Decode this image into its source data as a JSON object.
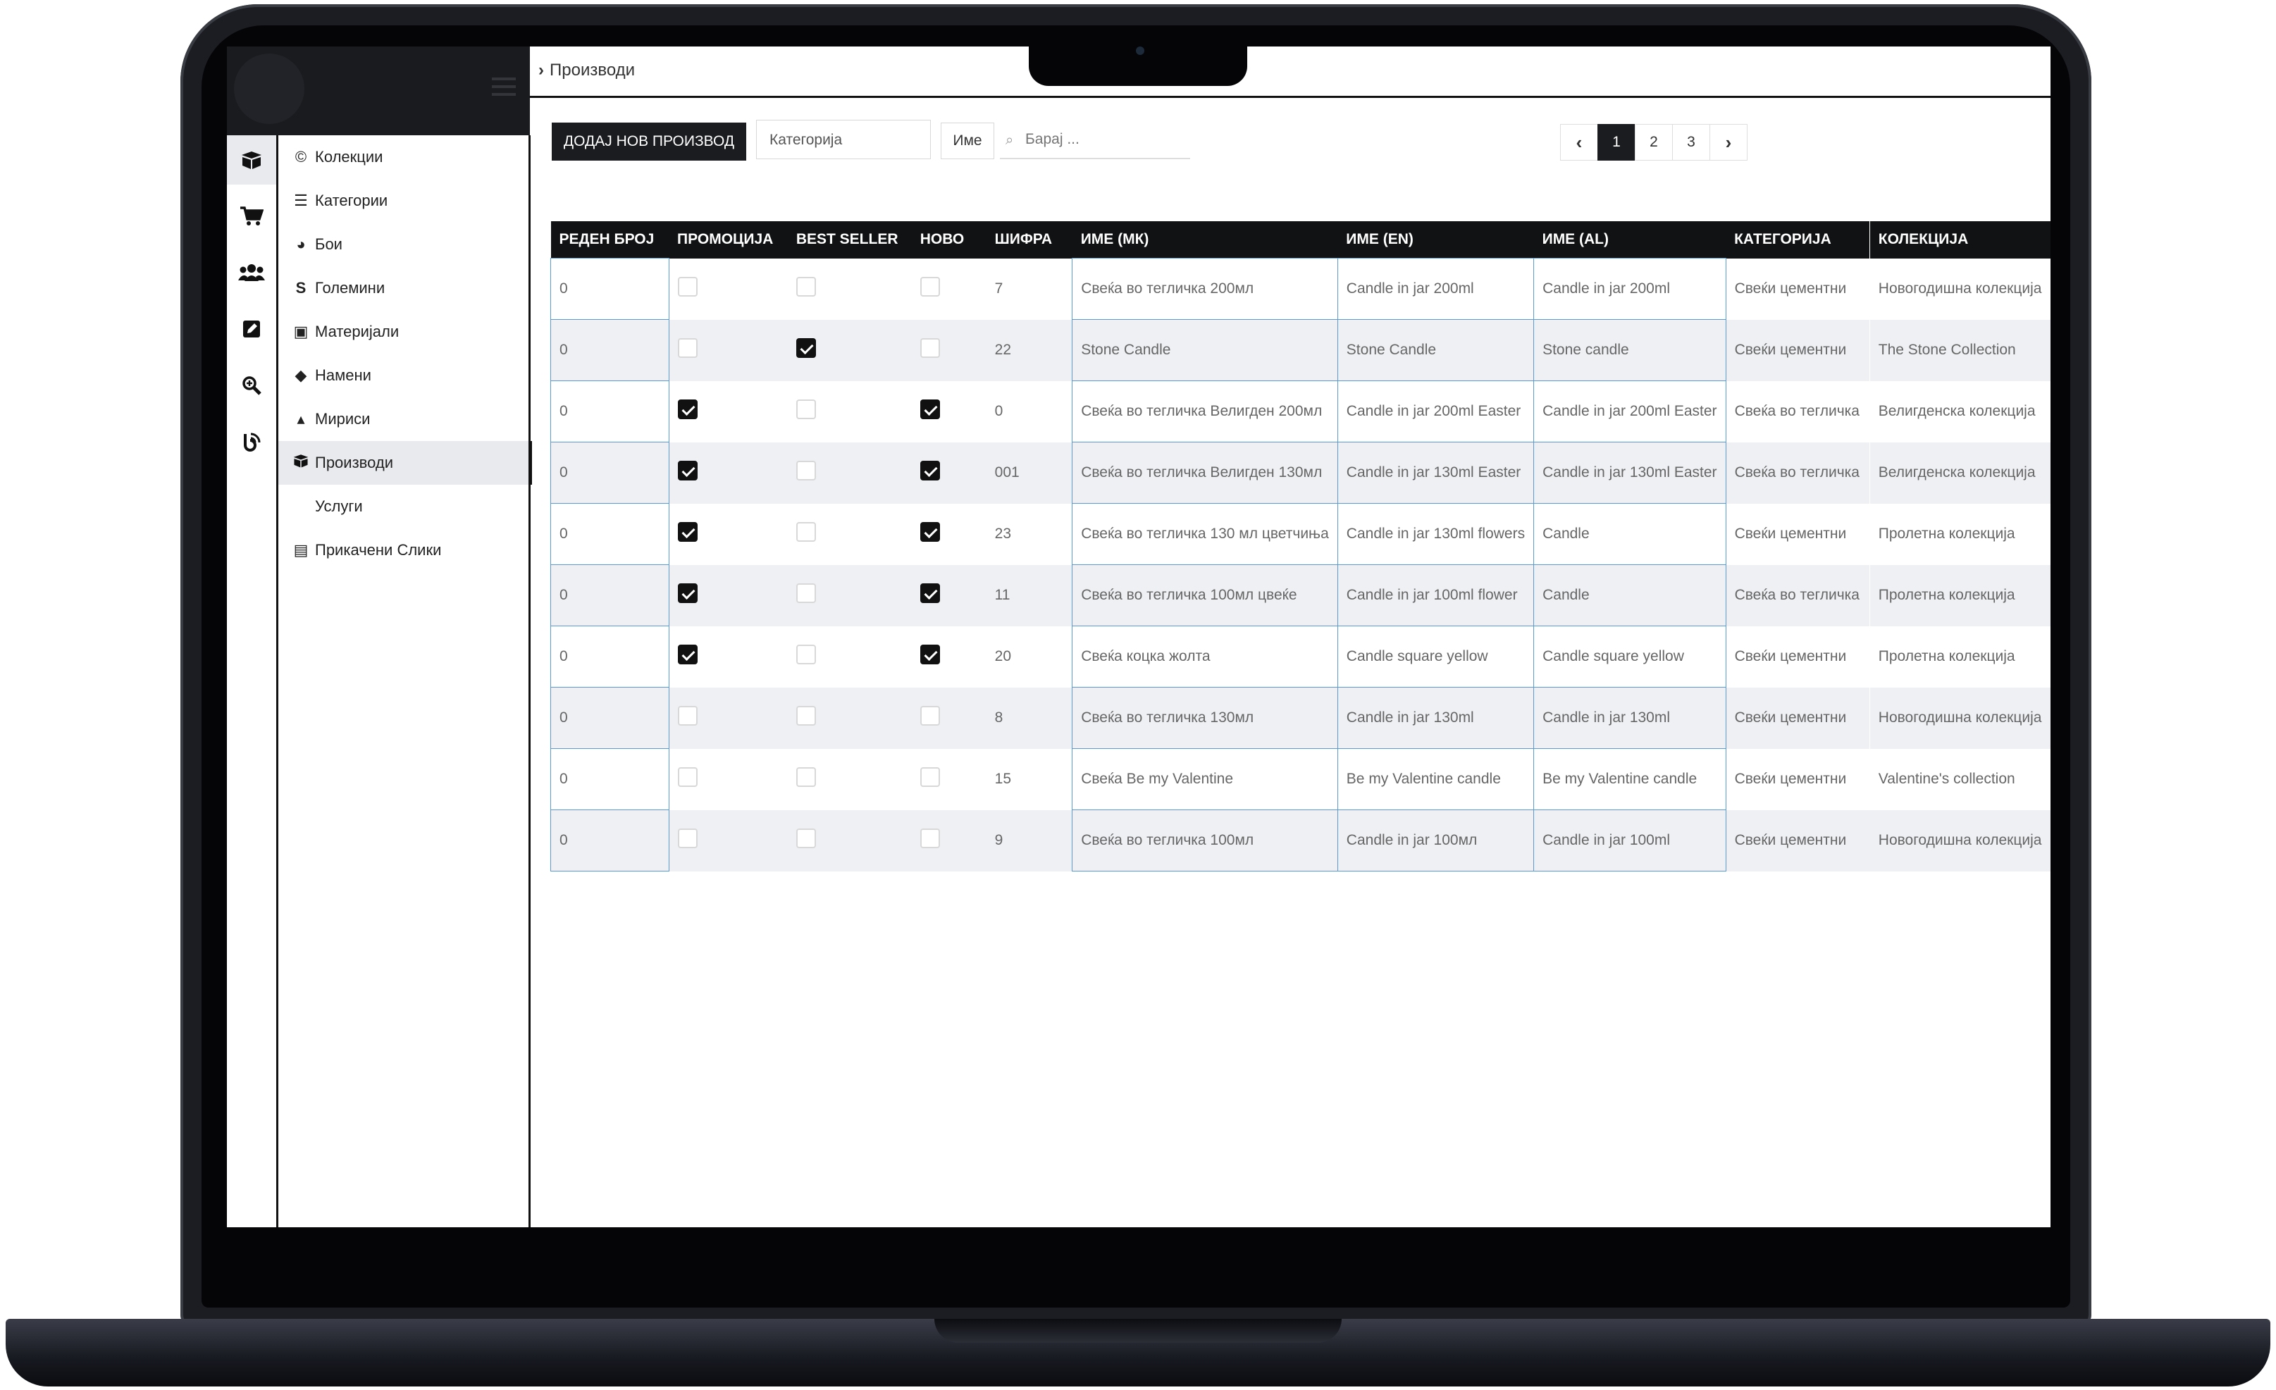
{
  "breadcrumb": {
    "current": "Производи"
  },
  "sidebar": {
    "items": [
      {
        "label": "Колекции",
        "icon": "copyright-icon",
        "active": false
      },
      {
        "label": "Категории",
        "icon": "list-icon",
        "active": false
      },
      {
        "label": "Бои",
        "icon": "palette-icon",
        "active": false
      },
      {
        "label": "Големини",
        "icon": "dollar-s-icon",
        "active": false
      },
      {
        "label": "Материјали",
        "icon": "spray-icon",
        "active": false
      },
      {
        "label": "Намени",
        "icon": "cube-icon",
        "active": false
      },
      {
        "label": "Мириси",
        "icon": "droplet-icon",
        "active": false
      },
      {
        "label": "Производи",
        "icon": "box-open-icon",
        "active": true
      },
      {
        "label": "Услуги",
        "icon": "",
        "active": false
      },
      {
        "label": "Прикачени Слики",
        "icon": "images-icon",
        "active": false
      }
    ]
  },
  "rail": {
    "icons": [
      "box-open-icon",
      "cart-icon",
      "users-icon",
      "edit-icon",
      "search-plus-icon",
      "blog-icon"
    ]
  },
  "toolbar": {
    "add_label": "ДОДАЈ НОВ ПРОИЗВОД",
    "category_placeholder": "Категорија",
    "name_select": "Име",
    "search_placeholder": "Барај ..."
  },
  "pager": {
    "pages": [
      "1",
      "2",
      "3"
    ],
    "current": "1"
  },
  "table": {
    "columns": [
      "РЕДЕН БРОЈ",
      "ПРОМОЦИЈА",
      "BEST SELLER",
      "НОВО",
      "ШИФРА",
      "ИМЕ (МК)",
      "ИМЕ (EN)",
      "ИМЕ (AL)",
      "КАТЕГОРИЈА",
      "КОЛЕКЦИЈА"
    ],
    "rows": [
      {
        "order": "0",
        "promo": false,
        "best": false,
        "new": false,
        "code": "7",
        "name_mk": "Свеќа во тегличка 200мл",
        "name_en": "Candle in jar 200ml",
        "name_al": "Candle in jar 200ml",
        "category": "Свеќи цементни",
        "collection": "Новогодишна колекција"
      },
      {
        "order": "0",
        "promo": false,
        "best": true,
        "new": false,
        "code": "22",
        "name_mk": "Stone Candle",
        "name_en": "Stone Candle",
        "name_al": "Stone candle",
        "category": "Свеќи цементни",
        "collection": "The Stone Collection"
      },
      {
        "order": "0",
        "promo": true,
        "best": false,
        "new": true,
        "code": "0",
        "name_mk": "Свеќа во тегличка Велигден 200мл",
        "name_en": "Candle in jar 200ml Easter",
        "name_al": "Candle in jar 200ml Easter",
        "category": "Свеќа во тегличка",
        "collection": "Велигденска колекција"
      },
      {
        "order": "0",
        "promo": true,
        "best": false,
        "new": true,
        "code": "001",
        "name_mk": "Свеќа во тегличка Велигден 130мл",
        "name_en": "Candle in jar 130ml Easter",
        "name_al": "Candle in jar 130ml Easter",
        "category": "Свеќа во тегличка",
        "collection": "Велигденска колекција"
      },
      {
        "order": "0",
        "promo": true,
        "best": false,
        "new": true,
        "code": "23",
        "name_mk": "Свеќа во тегличка 130 мл цветчиња",
        "name_en": "Candle in jar 130ml flowers",
        "name_al": "Candle",
        "category": "Свеќи цементни",
        "collection": "Пролетна колекција"
      },
      {
        "order": "0",
        "promo": true,
        "best": false,
        "new": true,
        "code": "11",
        "name_mk": "Свеќа во тегличка 100мл цвеќе",
        "name_en": "Candle in jar 100ml flower",
        "name_al": "Candle",
        "category": "Свеќа во тегличка",
        "collection": "Пролетна колекција"
      },
      {
        "order": "0",
        "promo": true,
        "best": false,
        "new": true,
        "code": "20",
        "name_mk": "Свеќа коцка жолта",
        "name_en": "Candle square yellow",
        "name_al": "Candle square yellow",
        "category": "Свеќи цементни",
        "collection": "Пролетна колекција"
      },
      {
        "order": "0",
        "promo": false,
        "best": false,
        "new": false,
        "code": "8",
        "name_mk": "Свеќа во тегличка 130мл",
        "name_en": "Candle in jar 130ml",
        "name_al": "Candle in jar 130ml",
        "category": "Свеќи цементни",
        "collection": "Новогодишна колекција"
      },
      {
        "order": "0",
        "promo": false,
        "best": false,
        "new": false,
        "code": "15",
        "name_mk": "Свеќа Be my Valentine",
        "name_en": "Be my Valentine candle",
        "name_al": "Be my Valentine candle",
        "category": "Свеќи цементни",
        "collection": "Valentine's collection"
      },
      {
        "order": "0",
        "promo": false,
        "best": false,
        "new": false,
        "code": "9",
        "name_mk": "Свеќа во тегличка 100мл",
        "name_en": "Candle in jar 100мл",
        "name_al": "Candle in jar 100ml",
        "category": "Свеќи цементни",
        "collection": "Новогодишна колекција"
      }
    ]
  },
  "colors": {
    "header_bg": "#111214",
    "edit_border": "#5b9bd5",
    "row_alt": "#eef0f3",
    "accent": "#1b1c20"
  }
}
